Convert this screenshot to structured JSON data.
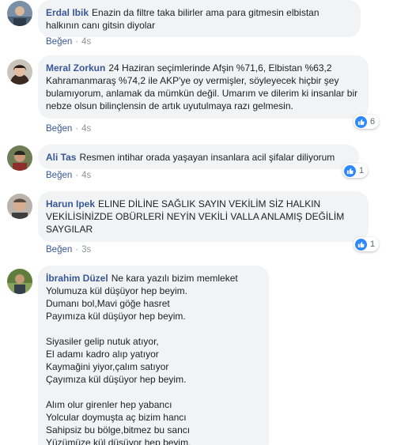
{
  "comments": [
    {
      "author": "Erdal Ibik",
      "text": "Enazin da filtre taka bilirler ama para gitmesin elbistan halkının canı gitsin diyolar",
      "like_label": "Beğen",
      "separator": "·",
      "time": "4s"
    },
    {
      "author": "Meral Zorkun",
      "text": "24 Haziran seçimlerinde Afşin %71,6, Elbistan %63,2 Kahramanmaraş %74,2 ile AKP'ye oy vermişler, söyleyecek hiçbir şey bulamıyorum, anlamak da mümkün değil. Umarım ve dilerim ki insanlar bir nebze olsun bilinçlensin de artık uyutulmaya razı gelmesin.",
      "like_label": "Beğen",
      "separator": "·",
      "time": "4s",
      "reaction_icon": "thumbs-up-icon",
      "reaction_count": "6"
    },
    {
      "author": "Ali Tas",
      "text": "Resmen intihar orada yaşayan insanlara acil şifalar diliyorum",
      "like_label": "Beğen",
      "separator": "·",
      "time": "4s",
      "reaction_icon": "thumbs-up-icon",
      "reaction_count": "1"
    },
    {
      "author": "Harun Ipek",
      "text": "ELINE DİLİNE SAĞLIK SAYIN VEKİLİM SİZ HALKIN VEKİLİSİNİZDE OBÜRLERİ NEYİN VEKİLİ VALLA ANLAMIŞ DEĞİLİM SAYGILAR",
      "like_label": "Beğen",
      "separator": "·",
      "time": "3s",
      "reaction_icon": "thumbs-up-icon",
      "reaction_count": "1"
    },
    {
      "author": "İbrahim Düzel",
      "first_line": "Ne kara yazılı bizim memleket",
      "stanza1": [
        "Yolumuza kül düşüyor hep beyim.",
        "Dumanı bol,Mavi göğe hasret",
        "Payımıza kül düşüyor hep beyim."
      ],
      "stanza2": [
        "Siyasiler gelip nutuk atıyor,",
        "El adamı kadro alıp yatıyor",
        "Kaymağini yiyor,çalım satıyor",
        "Çayımıza kül düşüyor hep beyim."
      ],
      "stanza3": [
        "Alım olur girenler hep yabancı",
        "Yolcular doymuşta aç bizim hancı",
        "Sahipsiz bu bölge,bitmez bu sancı",
        "Yüzümüze kül düşüyor hep beyim."
      ]
    }
  ],
  "colors": {
    "author_link": "#385898",
    "bubble_bg": "#f2f3f5",
    "meta_gray": "#90949c",
    "like_blue": "#2d88ff"
  }
}
